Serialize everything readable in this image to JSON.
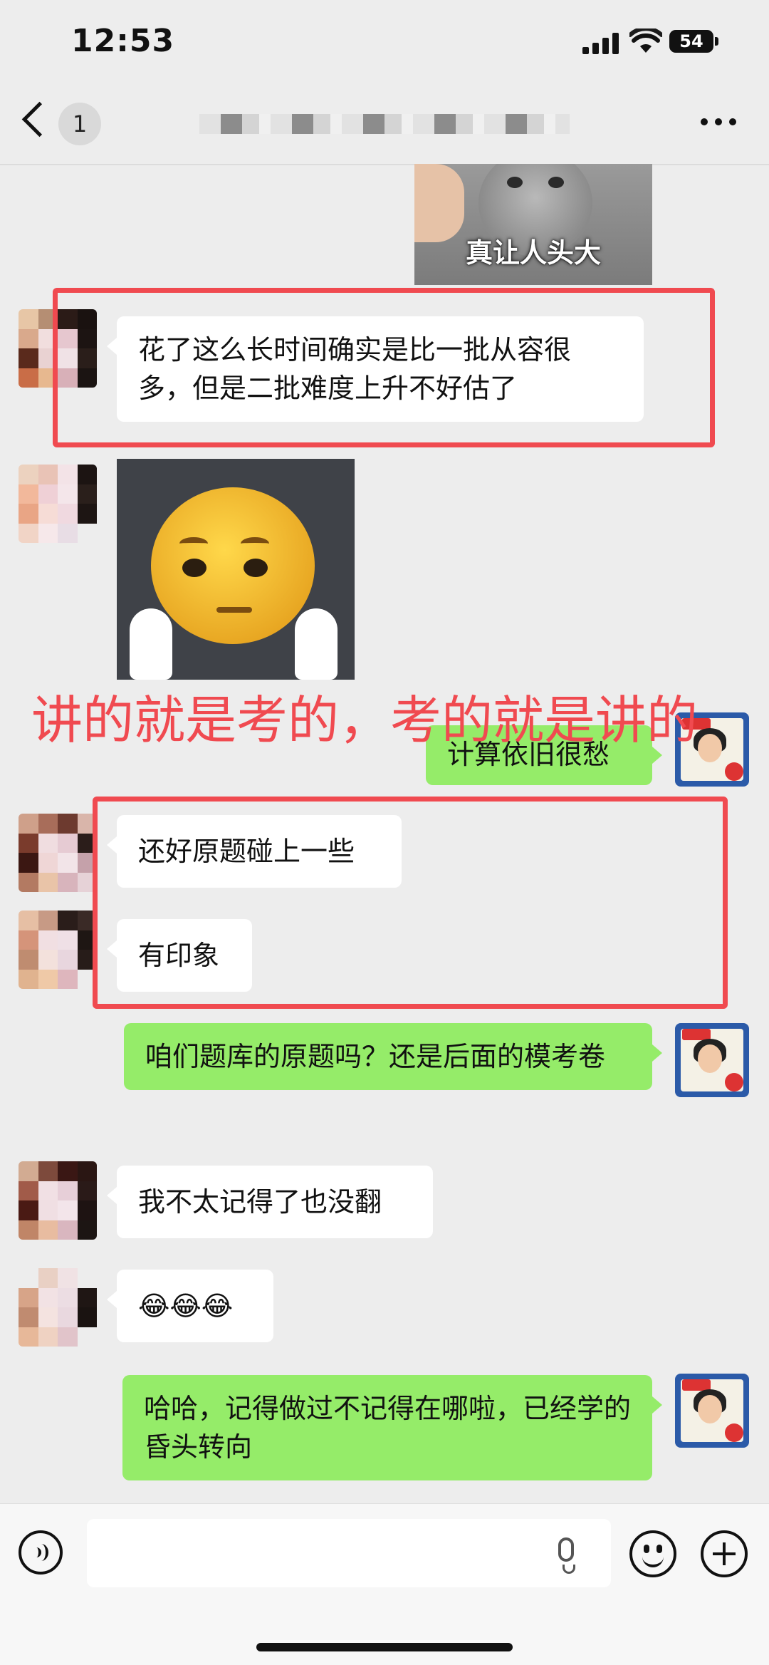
{
  "status_bar": {
    "time": "12:53",
    "battery": "54"
  },
  "nav": {
    "unread_count": "1"
  },
  "cat_sticker": {
    "caption": "真让人头大"
  },
  "messages": [
    {
      "from": "other",
      "text": "花了这么长时间确实是比一批从容很多，但是二批难度上升不好估了"
    },
    {
      "from": "self",
      "text": "计算依旧很愁"
    },
    {
      "from": "other",
      "text": "还好原题碰上一些"
    },
    {
      "from": "other",
      "text": "有印象"
    },
    {
      "from": "self",
      "text": "咱们题库的原题吗？还是后面的模考卷"
    },
    {
      "from": "other",
      "text": "我不太记得了也没翻"
    },
    {
      "from": "other",
      "text": "😂😂😂"
    },
    {
      "from": "self",
      "text": "哈哈，记得做过不记得在哪啦，已经学的昏头转向"
    }
  ],
  "annotation": {
    "text": "讲的就是考的，考的就是讲的"
  },
  "input": {
    "placeholder": ""
  },
  "colors": {
    "incoming": "#ffffff",
    "outgoing": "#95ec69",
    "highlight": "#f04a50",
    "background": "#ededed"
  },
  "icons": [
    "back-icon",
    "more-icon",
    "voice-icon",
    "mic-icon",
    "emoji-icon",
    "plus-icon"
  ]
}
